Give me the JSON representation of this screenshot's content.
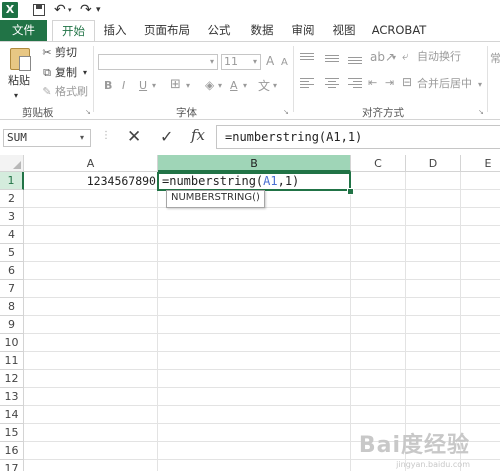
{
  "quick_access": {
    "excel_logo": "X"
  },
  "tabs": {
    "file": "文件",
    "home": "开始",
    "insert": "插入",
    "page_layout": "页面布局",
    "formulas": "公式",
    "data": "数据",
    "review": "审阅",
    "view": "视图",
    "acrobat": "ACROBAT"
  },
  "ribbon": {
    "clipboard": {
      "paste": "粘贴",
      "cut": "剪切",
      "copy": "复制",
      "format_painter": "格式刷",
      "group_label": "剪贴板"
    },
    "font": {
      "font_size": "11",
      "group_label": "字体"
    },
    "alignment": {
      "wrap_text": "自动换行",
      "merge_center": "合并后居中",
      "group_label": "对齐方式"
    },
    "number_cut": "常"
  },
  "formula_bar": {
    "name_box": "SUM",
    "fx": "fx",
    "formula": "=numberstring(A1,1)"
  },
  "grid": {
    "columns": [
      "A",
      "B",
      "C",
      "D",
      "E"
    ],
    "rows": [
      "1",
      "2",
      "3",
      "4",
      "5",
      "6",
      "7",
      "8",
      "9",
      "10",
      "11",
      "12",
      "13",
      "14",
      "15",
      "16",
      "17"
    ],
    "a1_value": "1234567890",
    "b1_formula_prefix": "=numberstring(",
    "b1_formula_ref": "A1",
    "b1_formula_suffix": ",1)",
    "tooltip": "NUMBERSTRING()"
  },
  "colors": {
    "accent": "#217346",
    "ref_blue": "#4a6fd1"
  },
  "watermark": {
    "text": "Bai度经验",
    "sub": "jingyan.baidu.com"
  }
}
